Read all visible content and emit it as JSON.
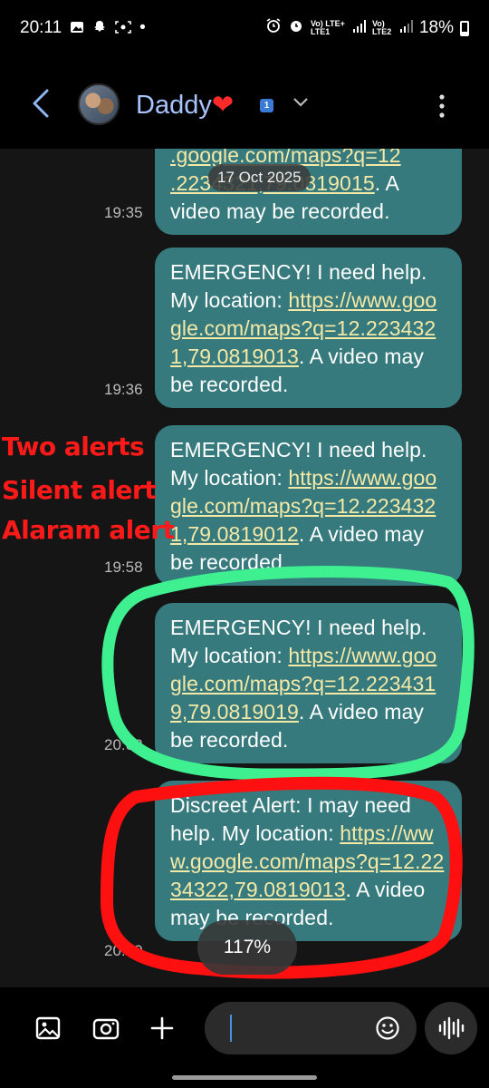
{
  "status_bar": {
    "time": "20:11",
    "dot": "•",
    "battery": "18%",
    "sim1": "Vo) LTE+ LTE1",
    "sim2": "Vo) LTE2"
  },
  "header": {
    "contact_name": "Daddy",
    "heart": "❤",
    "sim_badge": "1"
  },
  "date_chip": "17 Oct 2025",
  "messages": [
    {
      "time": "19:35",
      "text_pre": "",
      "link": "",
      "text_post": ". A video may be recorded.",
      "partial_top": ".google.com/maps?q=12",
      "partial_link2": ".2234321,79.0819015"
    },
    {
      "time": "19:36",
      "text_pre": "EMERGENCY! I need help. My location: ",
      "link": "https://www.google.com/maps?q=12.2234321,79.0819013",
      "text_post": ". A video may be recorded."
    },
    {
      "time": "19:58",
      "text_pre": "EMERGENCY! I need help. My location: ",
      "link": "https://www.google.com/maps?q=12.2234321,79.0819012",
      "text_post": ". A video may be recorded."
    },
    {
      "time": "20:02",
      "text_pre": "EMERGENCY! I need help. My location: ",
      "link": "https://www.google.com/maps?q=12.2234319,79.0819019",
      "text_post": ". A video may be recorded."
    },
    {
      "time": "20:10",
      "text_pre": "Discreet Alert: I may need help. My location: ",
      "link": "https://www.google.com/maps?q=12.2234322,79.0819013",
      "text_post": ". A video may be recorded."
    }
  ],
  "annotations": [
    "Two alerts",
    "Silent alert",
    "Alaram alert"
  ],
  "zoom_level": "117%",
  "colors": {
    "bubble": "#367a7d",
    "link": "#f5e9a8",
    "green_circle": "#3ef08f",
    "red_circle": "#ff1010",
    "contact": "#a9c3ff"
  }
}
